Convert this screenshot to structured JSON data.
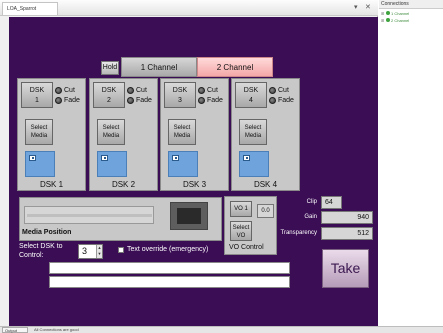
{
  "window": {
    "tab_title": "LOA_Sparrot",
    "pin_glyph": "▾",
    "close_glyph": "✕"
  },
  "channels": {
    "hold_label": "Hold",
    "channel_1_label": "1 Channel",
    "channel_2_label": "2 Channel"
  },
  "dsk_cards": [
    {
      "button_text": "DSK\n1",
      "cut_label": "Cut",
      "fade_label": "Fade",
      "media_label": "Select\nMedia",
      "caption": "DSK 1"
    },
    {
      "button_text": "DSK\n2",
      "cut_label": "Cut",
      "fade_label": "Fade",
      "media_label": "Select\nMedia",
      "caption": "DSK 2"
    },
    {
      "button_text": "DSK\n3",
      "cut_label": "Cut",
      "fade_label": "Fade",
      "media_label": "Select\nMedia",
      "caption": "DSK 3"
    },
    {
      "button_text": "DSK\n4",
      "cut_label": "Cut",
      "fade_label": "Fade",
      "media_label": "Select\nMedia",
      "caption": "DSK 4"
    }
  ],
  "media": {
    "label": "Media Position"
  },
  "vo": {
    "vo1_label": "VO 1",
    "vo_value": "0.0",
    "select_vo_label": "Select\nVO",
    "control_label": "VO Control"
  },
  "stats": {
    "clip_label": "Clip",
    "clip_value": "64",
    "gain_label": "Gain",
    "gain_value": "940",
    "transparency_label": "Transparency",
    "transparency_value": "512"
  },
  "select_dsk": {
    "label": "Select DSK to Control:",
    "value": "3"
  },
  "override": {
    "label": "Text override (emergency)"
  },
  "take_label": "Take",
  "status_bar": {
    "tab_label": "Output",
    "text": "All Connections are good"
  },
  "connections": {
    "title": "Connections",
    "items": [
      {
        "name": "1 Channel"
      },
      {
        "name": "2 Channel"
      }
    ]
  },
  "colors": {
    "panel_bg": "#3a0d54",
    "active_channel": "#f4a7a7",
    "thumb": "#6ea3dc",
    "status_ok": "#3fa43f"
  }
}
